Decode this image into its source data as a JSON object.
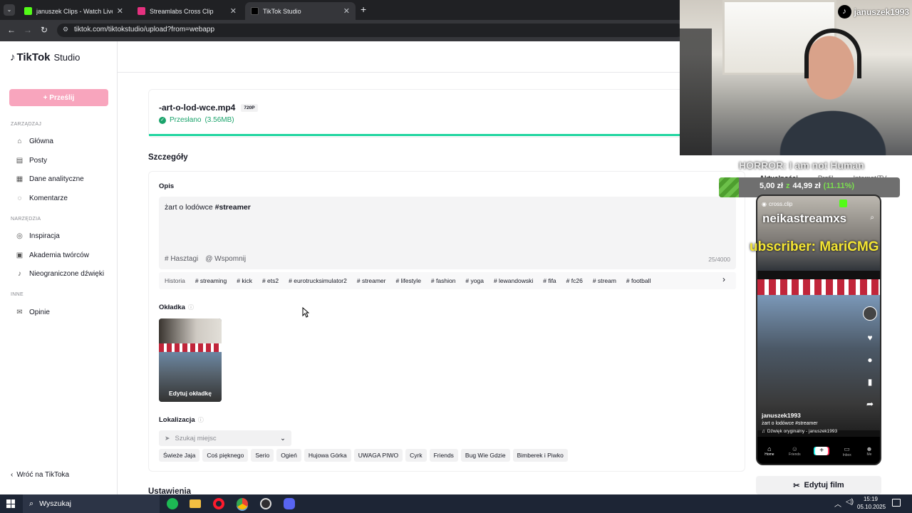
{
  "browser": {
    "tabs": [
      {
        "title": "januszek Clips - Watch Live on",
        "favicon_color": "#53fc18"
      },
      {
        "title": "Streamlabs Cross Clip",
        "favicon_color": "#e5317f"
      },
      {
        "title": "TikTok Studio",
        "favicon_color": "#000000"
      }
    ],
    "url": "tiktok.com/tiktokstudio/upload?from=webapp"
  },
  "sidebar": {
    "logo": "TikTok",
    "logo_suffix": "Studio",
    "upload_button": "+ Prześlij",
    "section_manage": "ZARZĄDZAJ",
    "manage_items": [
      {
        "label": "Główna",
        "icon": "home-icon"
      },
      {
        "label": "Posty",
        "icon": "posts-icon"
      },
      {
        "label": "Dane analityczne",
        "icon": "analytics-icon"
      },
      {
        "label": "Komentarze",
        "icon": "comments-icon"
      }
    ],
    "section_tools": "NARZĘDZIA",
    "tools_items": [
      {
        "label": "Inspiracja",
        "icon": "lightbulb-icon"
      },
      {
        "label": "Akademia twórców",
        "icon": "academy-icon"
      },
      {
        "label": "Nieograniczone dźwięki",
        "icon": "music-note-icon"
      }
    ],
    "section_other": "INNE",
    "other_items": [
      {
        "label": "Opinie",
        "icon": "feedback-icon"
      }
    ],
    "back_link": "Wróć na TikToka"
  },
  "upload": {
    "filename": "-art-o-lod-wce.mp4",
    "quality_badge": "720P",
    "status": "Przesłano",
    "size": "(3.56MB)",
    "progress": 1.0
  },
  "details": {
    "heading": "Szczegóły",
    "description_label": "Opis",
    "description_text": "żart o lodówce",
    "description_hashtag": "#streamer",
    "hashtags_button": "# Hasztagi",
    "mention_button": "@ Wspomnij",
    "char_count": "25/4000",
    "history_label": "Historia",
    "hashtag_suggestions": [
      "# streaming",
      "# kick",
      "# ets2",
      "# eurotrucksimulator2",
      "# streamer",
      "# lifestyle",
      "# fashion",
      "# yoga",
      "# lewandowski",
      "# fifa",
      "# fc26",
      "# stream",
      "# football"
    ],
    "cover_label": "Okładka",
    "cover_edit": "Edytuj okładkę",
    "location_label": "Lokalizacja",
    "location_placeholder": "Szukaj miejsc",
    "location_suggestions": [
      "Świeże Jaja",
      "Coś pięknego",
      "Serio",
      "Ogień",
      "Hujowa Górka",
      "UWAGA PIWO",
      "Cyrk",
      "Friends",
      "Bug Wie Gdzie",
      "Bimberek i Piwko"
    ],
    "settings_heading": "Ustawienia"
  },
  "overlay": {
    "webcam_username": "januszek1993",
    "stream_title": "HORROR: I am not Human",
    "store_tabs": [
      "Aktualności",
      "Profil",
      "Internet/TV"
    ],
    "price_old": "5,00 zł",
    "price_sep": "z",
    "price_new": "44,99 zł",
    "price_pct": "(11.11%)",
    "follow_banner": "neikastreamxs",
    "sub_banner": "ubscriber: MariCMG",
    "phone": {
      "watermark": "cross.clip",
      "username": "januszek1993",
      "caption": "żart o lodówce #streamer",
      "sound": "Dźwięk oryginalny - januszek1993",
      "nav": [
        "Home",
        "Friends",
        "",
        "Inbox",
        "Me"
      ]
    },
    "edit_video_button": "Edytuj film"
  },
  "taskbar": {
    "search_placeholder": "Wyszukaj",
    "time": "15:19",
    "date": "05.10.2025"
  }
}
